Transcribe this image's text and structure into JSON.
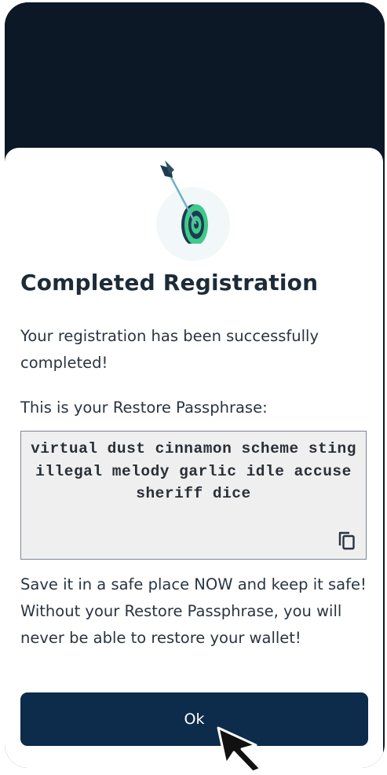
{
  "dialog": {
    "title": "Completed Registration",
    "success_message": "Your registration has been successfully completed!",
    "passphrase_intro": "This is your Restore Passphrase:",
    "passphrase": "virtual dust cinnamon scheme sting illegal melody garlic idle accuse sheriff dice",
    "warning": "Save it in a safe place NOW and keep it safe! Without your Restore Passphrase, you will never be able to restore your wallet!",
    "ok_label": "Ok"
  },
  "icons": {
    "illustration": "target-arrow-icon",
    "copy": "copy-icon",
    "cursor": "mouse-pointer-icon"
  },
  "colors": {
    "background_dark": "#0c1826",
    "button": "#0d2b4a",
    "accent_green": "#3fc98b",
    "text": "#1d2b38"
  }
}
